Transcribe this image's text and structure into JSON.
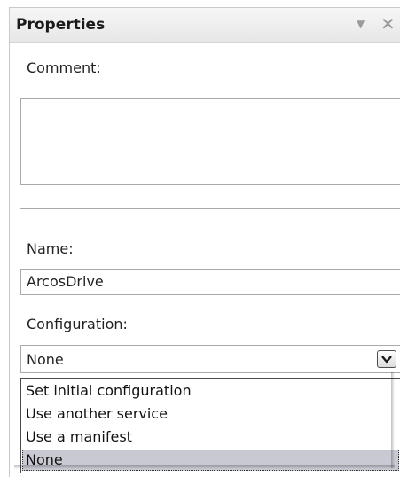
{
  "panel": {
    "title": "Properties",
    "pin_icon": "dropdown-arrow-icon",
    "close_icon": "close-icon"
  },
  "comment": {
    "label": "Comment:",
    "value": ""
  },
  "name": {
    "label": "Name:",
    "value": "ArcosDrive"
  },
  "configuration": {
    "label": "Configuration:",
    "selected": "None",
    "options": [
      "Set initial configuration",
      "Use another service",
      "Use a manifest",
      "None"
    ],
    "highlighted_index": 3
  },
  "colors": {
    "highlight": "#c9c9d3",
    "border": "#a9a9a9"
  }
}
